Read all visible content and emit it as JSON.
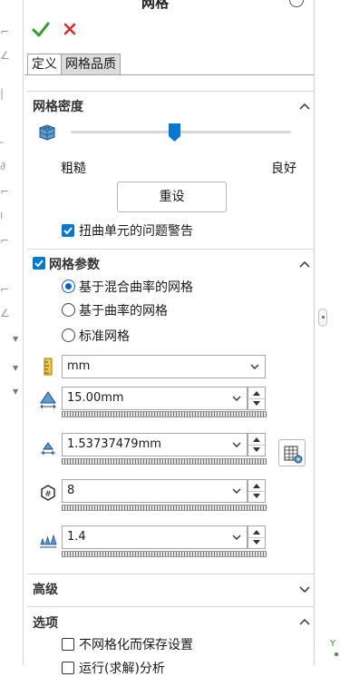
{
  "window": {
    "title": "网格"
  },
  "actions": {
    "ok_icon": "check-icon",
    "cancel_icon": "close-icon"
  },
  "tabs": [
    {
      "label": "定义",
      "active": true
    },
    {
      "label": "网格品质",
      "active": false
    }
  ],
  "density": {
    "title": "网格密度",
    "slider_level": 0.47,
    "min_label": "粗糙",
    "max_label": "良好",
    "reset_label": "重设",
    "warn_label": "扭曲单元的问题警告",
    "warn_checked": true
  },
  "params": {
    "title": "网格参数",
    "enabled": true,
    "options": [
      {
        "label": "基于混合曲率的网格",
        "selected": true
      },
      {
        "label": "基于曲率的网格",
        "selected": false
      },
      {
        "label": "标准网格",
        "selected": false
      }
    ],
    "unit_value": "mm",
    "max_size_value": "15.00mm",
    "min_size_value": "1.53737479mm",
    "min_elements_value": "8",
    "growth_ratio_value": "1.4"
  },
  "advanced": {
    "title": "高级"
  },
  "options_section": {
    "title": "选项",
    "no_mesh_label": "不网格化而保存设置",
    "run_label": "运行(求解)分析"
  },
  "colors": {
    "accent": "#0078d4",
    "ok": "#2e9e2e",
    "cancel": "#d42a2a"
  }
}
